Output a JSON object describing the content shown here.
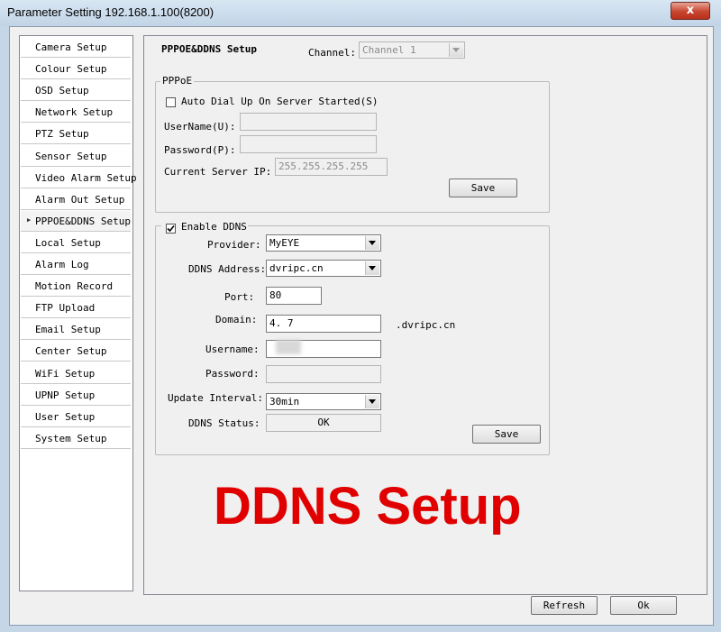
{
  "window": {
    "title": "Parameter Setting 192.168.1.100(8200)",
    "close_label": "x"
  },
  "sidebar": {
    "items": [
      {
        "label": "Camera Setup"
      },
      {
        "label": "Colour Setup"
      },
      {
        "label": "OSD Setup"
      },
      {
        "label": "Network Setup"
      },
      {
        "label": "PTZ Setup"
      },
      {
        "label": "Sensor Setup"
      },
      {
        "label": "Video Alarm Setup"
      },
      {
        "label": "Alarm Out Setup"
      },
      {
        "label": "PPPOE&DDNS Setup",
        "active": true
      },
      {
        "label": "Local Setup"
      },
      {
        "label": "Alarm Log"
      },
      {
        "label": "Motion Record"
      },
      {
        "label": "FTP Upload"
      },
      {
        "label": "Email Setup"
      },
      {
        "label": "Center Setup"
      },
      {
        "label": "WiFi Setup"
      },
      {
        "label": "UPNP Setup"
      },
      {
        "label": "User Setup"
      },
      {
        "label": "System Setup"
      }
    ]
  },
  "header": {
    "title": "PPPOE&DDNS Setup",
    "channel_label": "Channel:",
    "channel_value": "Channel 1"
  },
  "pppoe": {
    "group_title": "PPPoE",
    "auto_dial_label": "Auto Dial Up On Server Started(S)",
    "auto_dial_checked": false,
    "username_label": "UserName(U):",
    "username_value": "",
    "password_label": "Password(P):",
    "password_value": "",
    "server_ip_label": "Current Server IP:",
    "server_ip_value": "255.255.255.255",
    "save_label": "Save"
  },
  "ddns": {
    "enable_label": "Enable DDNS",
    "enable_checked": true,
    "provider_label": "Provider:",
    "provider_value": "MyEYE",
    "address_label": "DDNS Address:",
    "address_value": "dvripc.cn",
    "port_label": "Port:",
    "port_value": "80",
    "domain_label": "Domain:",
    "domain_value": "4.   7",
    "domain_suffix": ".dvripc.cn",
    "username_label": "Username:",
    "username_value": "",
    "password_label": "Password:",
    "password_value": "",
    "interval_label": "Update Interval:",
    "interval_value": "30min",
    "status_label": "DDNS Status:",
    "status_value": "OK",
    "save_label": "Save"
  },
  "overlay": {
    "caption": "DDNS Setup",
    "color": "#e00000"
  },
  "footer": {
    "refresh_label": "Refresh",
    "ok_label": "Ok"
  }
}
